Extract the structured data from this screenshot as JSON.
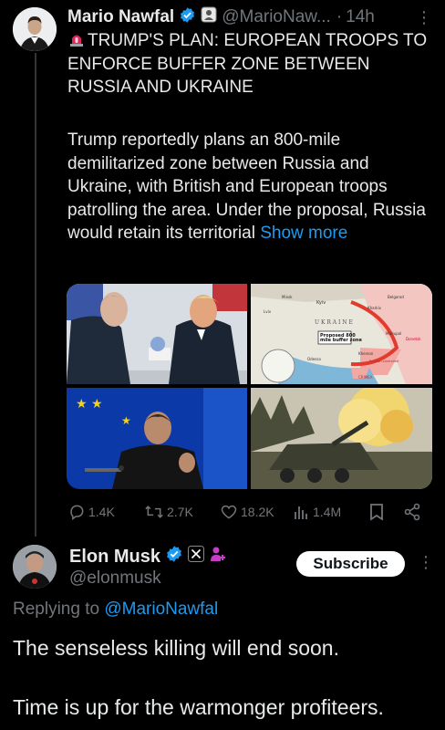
{
  "tweet": {
    "author_name": "Mario Nawfal",
    "handle": "@MarioNaw...",
    "separator": "·",
    "time": "14h",
    "headline": "TRUMP'S PLAN: EUROPEAN TROOPS TO ENFORCE BUFFER ZONE BETWEEN RUSSIA AND UKRAINE",
    "body": "Trump reportedly plans an 800-mile demilitarized zone between Russia and Ukraine, with British and European troops patrolling the area. Under the proposal, Russia would retain its territorial",
    "show_more": "Show more",
    "map": {
      "title": "U K R A I N E",
      "callout": "Proposed 800 mile buffer zone",
      "labels": [
        "Minsk",
        "Kyiv",
        "Lviv",
        "Kharkiv",
        "Belgorod",
        "Mariupol",
        "Donetsk",
        "Kherson",
        "Odessa",
        "CRIMEA",
        "Russian-controlled"
      ]
    },
    "stats": {
      "replies": "1.4K",
      "reposts": "2.7K",
      "likes": "18.2K",
      "views": "1.4M"
    }
  },
  "reply": {
    "author_name": "Elon Musk",
    "handle": "@elonmusk",
    "subscribe_label": "Subscribe",
    "replying_prefix": "Replying to",
    "replying_to": "@MarioNawfal",
    "line1": "The senseless killing will end soon.",
    "line2": "Time is up for the warmonger profiteers."
  },
  "colors": {
    "background": "#000000",
    "text": "#e7e9ea",
    "muted": "#71767b",
    "link": "#1d9bf0",
    "verified": "#1d9bf0",
    "affiliate": "#c63ec8"
  }
}
